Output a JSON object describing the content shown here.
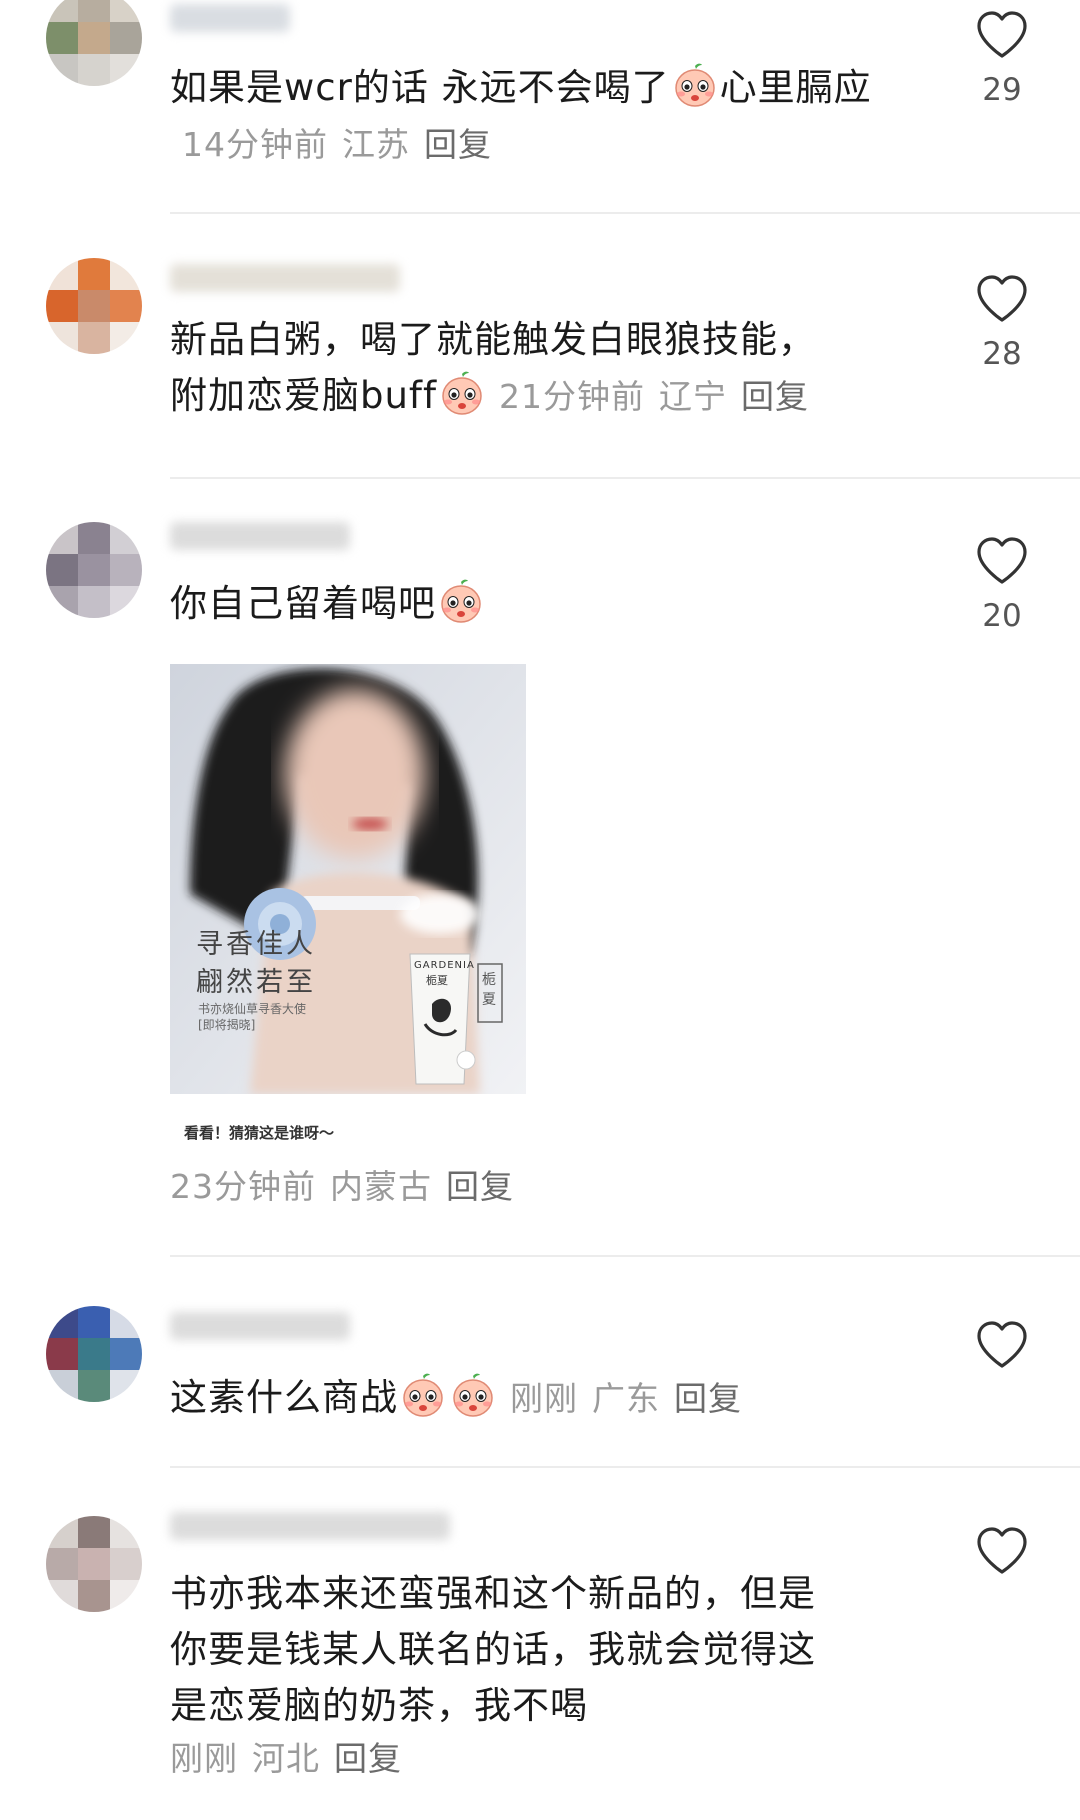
{
  "comments": [
    {
      "text_a": "如果是wcr的话 永远不会喝了",
      "text_b": "心里膈应",
      "time": "14分钟前",
      "region": "江苏",
      "reply": "回复",
      "likes": "29",
      "emoji": "blush-face-icon"
    },
    {
      "text_line1": "新品白粥，喝了就能触发白眼狼技能，",
      "text_line2": "附加恋爱脑buff",
      "time": "21分钟前",
      "region": "辽宁",
      "reply": "回复",
      "likes": "28",
      "emoji": "kiss-face-icon"
    },
    {
      "text": "你自己留着喝吧",
      "likes": "20",
      "emoji": "smile-face-icon",
      "image": {
        "headline_1": "寻香佳人",
        "headline_2": "翩然若至",
        "sub_1": "书亦烧仙草寻香大使",
        "sub_2": "[即将揭晓]",
        "brand": "GARDENIA",
        "product": "栀夏",
        "side_label": "栀夏",
        "caption": "看看！猜猜这是谁呀～"
      },
      "time": "23分钟前",
      "region": "内蒙古",
      "reply": "回复"
    },
    {
      "text": "这素什么商战",
      "time": "刚刚",
      "region": "广东",
      "reply": "回复",
      "emoji": "shocked-face-icon"
    },
    {
      "text_line1": "书亦我本来还蛮强和这个新品的，但是",
      "text_line2": "你要是钱某人联名的话，我就会觉得这",
      "text_line3": "是恋爱脑的奶茶，我不喝",
      "time": "刚刚",
      "region": "河北",
      "reply": "回复"
    }
  ],
  "colors": {
    "text": "#1b1b1b",
    "meta": "#9a9a9a",
    "divider": "#ececec"
  }
}
